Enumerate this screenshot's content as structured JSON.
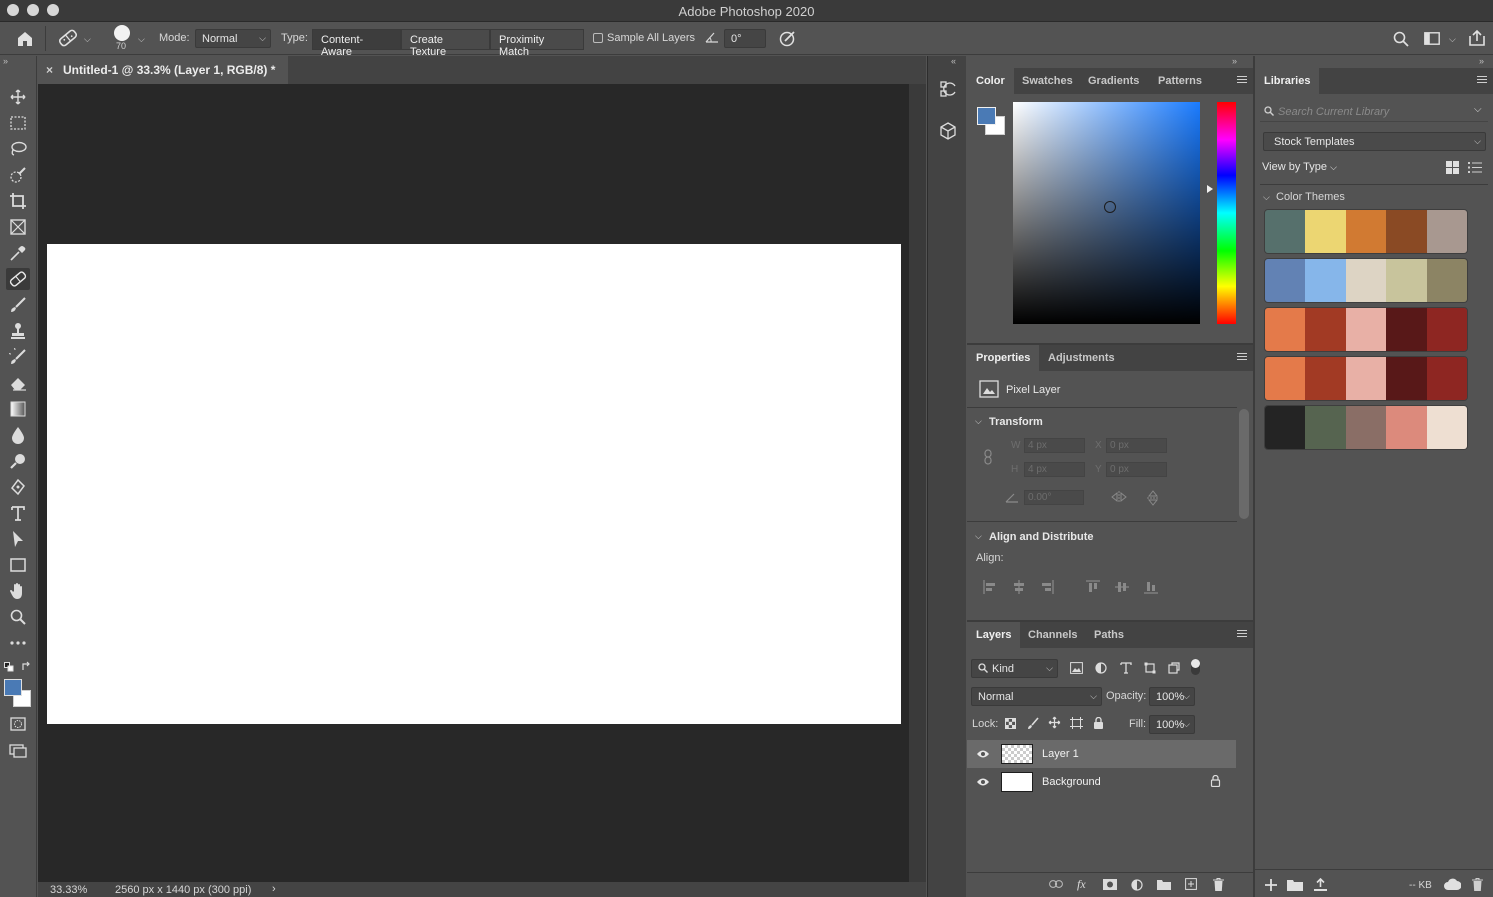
{
  "window": {
    "title": "Adobe Photoshop 2020"
  },
  "options_bar": {
    "brush_size": "70",
    "mode_label": "Mode:",
    "mode_value": "Normal",
    "type_label": "Type:",
    "type_buttons": [
      "Content-Aware",
      "Create Texture",
      "Proximity Match"
    ],
    "sample_all_layers": "Sample All Layers",
    "angle_value": "0°"
  },
  "document": {
    "tab_title": "Untitled-1 @ 33.3% (Layer 1, RGB/8) *",
    "zoom": "33.33%",
    "dimensions": "2560 px x 1440 px (300 ppi)"
  },
  "color_panel": {
    "tabs": [
      "Color",
      "Swatches",
      "Gradients",
      "Patterns"
    ],
    "foreground": "#4a7ab5",
    "background": "#ffffff",
    "hue_base": "#1a7bff"
  },
  "properties_panel": {
    "tabs": [
      "Properties",
      "Adjustments"
    ],
    "layer_kind": "Pixel Layer",
    "transform_title": "Transform",
    "w_label": "W",
    "w_value": "4 px",
    "h_label": "H",
    "h_value": "4 px",
    "x_label": "X",
    "x_value": "0 px",
    "y_label": "Y",
    "y_value": "0 px",
    "angle_value": "0.00°",
    "align_title": "Align and Distribute",
    "align_label": "Align:"
  },
  "layers_panel": {
    "tabs": [
      "Layers",
      "Channels",
      "Paths"
    ],
    "filter_kind": "Kind",
    "blend_mode": "Normal",
    "opacity_label": "Opacity:",
    "opacity_value": "100%",
    "lock_label": "Lock:",
    "fill_label": "Fill:",
    "fill_value": "100%",
    "layers": [
      {
        "name": "Layer 1",
        "selected": true,
        "transparent": true
      },
      {
        "name": "Background",
        "selected": false,
        "locked": true
      }
    ]
  },
  "libraries_panel": {
    "tab": "Libraries",
    "search_placeholder": "Search Current Library",
    "library_select": "Stock Templates",
    "view_by": "View by Type",
    "section": "Color Themes",
    "size_text": "-- KB",
    "themes": [
      [
        "#56706c",
        "#ecd672",
        "#d17a32",
        "#8a4a24",
        "#a89890"
      ],
      [
        "#6282b4",
        "#86b6ea",
        "#ddd4c4",
        "#c8c49c",
        "#8c8464"
      ],
      [
        "#e47a4a",
        "#a23a24",
        "#e8b0a6",
        "#581818",
        "#8e2622"
      ],
      [
        "#e47a4a",
        "#a23a24",
        "#e8b0a6",
        "#581818",
        "#8e2622"
      ],
      [
        "#242424",
        "#566450",
        "#8a6e66",
        "#dc8a7c",
        "#eedfd2"
      ]
    ]
  }
}
